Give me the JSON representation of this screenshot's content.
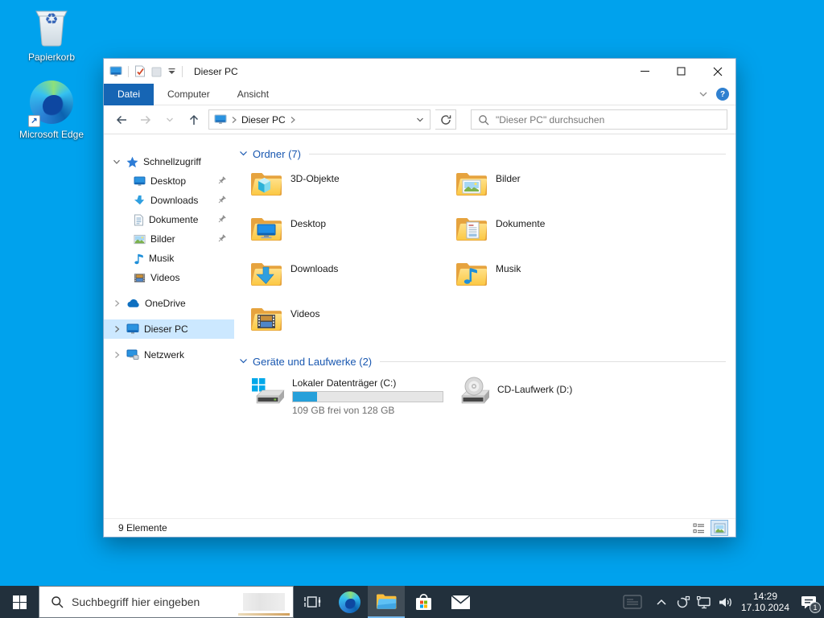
{
  "colors": {
    "desktop_bg": "#00a2ed",
    "taskbar_bg": "#22303c",
    "file_tab_blue": "#1665b4",
    "selection_blue": "#cce8ff",
    "drive_bar_fill": "#26a0da",
    "group_header_blue": "#1857b0"
  },
  "icons": {
    "help": "?",
    "shortcut_arrow": "↗",
    "recycle": "♻"
  },
  "desktop_icons": [
    {
      "label": "Papierkorb"
    },
    {
      "label": "Microsoft Edge"
    }
  ],
  "window": {
    "title": "Dieser PC",
    "tabs": [
      {
        "label": "Datei"
      },
      {
        "label": "Computer"
      },
      {
        "label": "Ansicht"
      }
    ],
    "nav": {
      "breadcrumb_root": "Dieser PC",
      "search_placeholder": "\"Dieser PC\" durchsuchen"
    },
    "sidebar": {
      "items": [
        {
          "label": "Schnellzugriff"
        },
        {
          "label": "Desktop",
          "pinned": true
        },
        {
          "label": "Downloads",
          "pinned": true
        },
        {
          "label": "Dokumente",
          "pinned": true
        },
        {
          "label": "Bilder",
          "pinned": true
        },
        {
          "label": "Musik"
        },
        {
          "label": "Videos"
        },
        {
          "label": "OneDrive"
        },
        {
          "label": "Dieser PC",
          "selected": true
        },
        {
          "label": "Netzwerk"
        }
      ]
    },
    "content": {
      "groups": [
        {
          "title": "Ordner (7)"
        },
        {
          "title": "Geräte und Laufwerke (2)"
        }
      ],
      "folders": [
        {
          "name": "3D-Objekte"
        },
        {
          "name": "Bilder"
        },
        {
          "name": "Desktop"
        },
        {
          "name": "Dokumente"
        },
        {
          "name": "Downloads"
        },
        {
          "name": "Musik"
        },
        {
          "name": "Videos"
        }
      ],
      "drives": [
        {
          "name": "Lokaler Datenträger (C:)",
          "free_text": "109 GB frei von 128 GB",
          "used_percent": 16,
          "fill_style": "width:16%"
        },
        {
          "name": "CD-Laufwerk (D:)"
        }
      ]
    },
    "statusbar": {
      "count": "9 Elemente"
    }
  },
  "taskbar": {
    "search_placeholder": "Suchbegriff hier eingeben",
    "clock": {
      "time": "14:29",
      "date": "17.10.2024"
    },
    "notification_count": "1"
  }
}
